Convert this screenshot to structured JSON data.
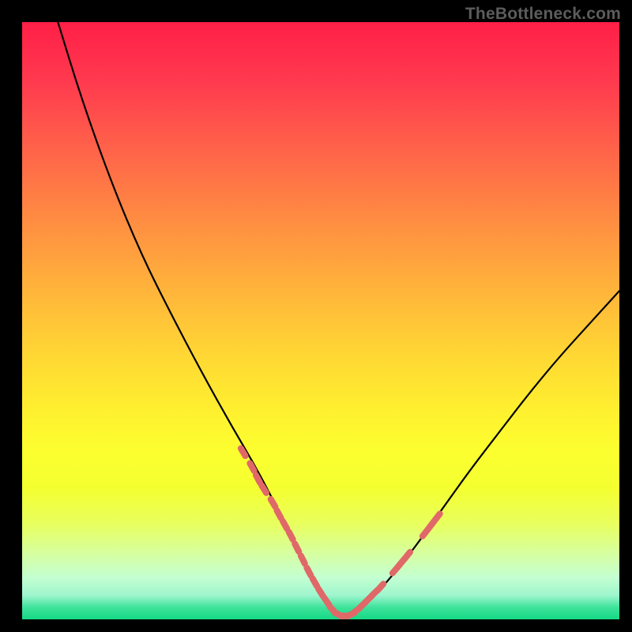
{
  "watermark": "TheBottleneck.com",
  "colors": {
    "page_bg": "#000000",
    "curve_stroke": "#000000",
    "dot_fill": "#e06868",
    "watermark_text": "#5c5c5c",
    "gradient_top": "#ff1f47",
    "gradient_bottom": "#15d984"
  },
  "chart_data": {
    "type": "line",
    "title": "",
    "xlabel": "",
    "ylabel": "",
    "xlim": [
      0,
      100
    ],
    "ylim": [
      0,
      100
    ],
    "grid": false,
    "legend": false,
    "note": "Axes are unlabeled in the source image; x and y are normalized 0–100. Curve is V-shaped with minimum near x≈53, y≈0. Left branch from (6,100) concave. Right branch to (100,55).",
    "series": [
      {
        "name": "curve",
        "x": [
          6,
          10,
          15,
          20,
          25,
          30,
          35,
          40,
          45,
          48,
          51,
          53,
          55,
          57,
          60,
          65,
          70,
          75,
          80,
          85,
          90,
          95,
          100
        ],
        "y": [
          100,
          87,
          73,
          61,
          51,
          41.5,
          32.5,
          24,
          14,
          8,
          3,
          0.5,
          0.5,
          2,
          5,
          11,
          18,
          25,
          31.5,
          38,
          44,
          49.5,
          55
        ]
      }
    ],
    "overlay_dots": {
      "name": "dotted-segments",
      "note": "Pink dash-dot markers overlaid near the bottom of the V on both branches.",
      "points": [
        {
          "x": 37,
          "y": 28
        },
        {
          "x": 38.5,
          "y": 25.5
        },
        {
          "x": 39.5,
          "y": 23.5
        },
        {
          "x": 40.5,
          "y": 21.8
        },
        {
          "x": 42,
          "y": 19.5
        },
        {
          "x": 43,
          "y": 17.6
        },
        {
          "x": 44,
          "y": 15.8
        },
        {
          "x": 45,
          "y": 14
        },
        {
          "x": 46,
          "y": 12
        },
        {
          "x": 47,
          "y": 10
        },
        {
          "x": 48,
          "y": 8
        },
        {
          "x": 49,
          "y": 6.2
        },
        {
          "x": 50,
          "y": 4.5
        },
        {
          "x": 51,
          "y": 3
        },
        {
          "x": 52,
          "y": 1.6
        },
        {
          "x": 53,
          "y": 0.8
        },
        {
          "x": 54,
          "y": 0.6
        },
        {
          "x": 55,
          "y": 0.8
        },
        {
          "x": 56,
          "y": 1.5
        },
        {
          "x": 57,
          "y": 2.4
        },
        {
          "x": 58,
          "y": 3.4
        },
        {
          "x": 59,
          "y": 4.4
        },
        {
          "x": 60,
          "y": 5.4
        },
        {
          "x": 62.5,
          "y": 8.3
        },
        {
          "x": 63.5,
          "y": 9.5
        },
        {
          "x": 64.5,
          "y": 10.7
        },
        {
          "x": 67.5,
          "y": 14.5
        },
        {
          "x": 68.5,
          "y": 15.8
        },
        {
          "x": 69.5,
          "y": 17.1
        }
      ]
    }
  }
}
